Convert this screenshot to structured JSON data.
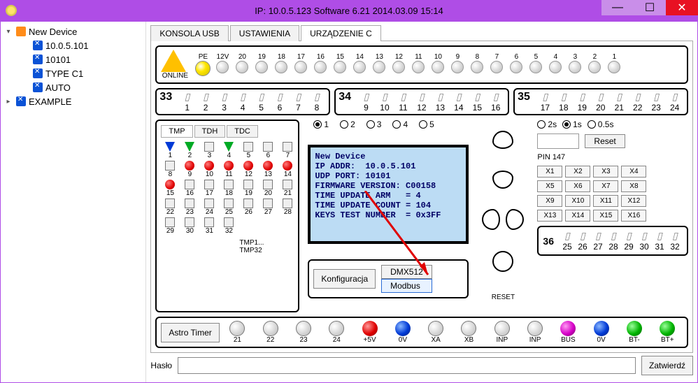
{
  "title": "IP: 10.0.5.123   Software 6.21  2014.03.09  15:14",
  "win_controls": {
    "min": "—",
    "max": "☐",
    "close": "✕"
  },
  "tree": [
    {
      "level": 0,
      "expand": "▾",
      "color": "orange",
      "label": "New Device"
    },
    {
      "level": 1,
      "color": "blue",
      "label": "10.0.5.101"
    },
    {
      "level": 1,
      "color": "blue",
      "label": "10101"
    },
    {
      "level": 1,
      "color": "blue",
      "label": "TYPE C1"
    },
    {
      "level": 1,
      "color": "blue",
      "label": "AUTO"
    },
    {
      "level": 0,
      "expand": "▸",
      "color": "blue",
      "label": "EXAMPLE"
    }
  ],
  "tabs": [
    {
      "label": "KONSOLA USB",
      "active": false
    },
    {
      "label": "USTAWIENIA",
      "active": false
    },
    {
      "label": "URZĄDZENIE C",
      "active": true
    }
  ],
  "online_label": "ONLINE",
  "top_channels": [
    "PE",
    "12V",
    "20",
    "19",
    "18",
    "17",
    "16",
    "15",
    "14",
    "13",
    "12",
    "11",
    "10",
    "9",
    "8",
    "7",
    "6",
    "5",
    "4",
    "3",
    "2",
    "1"
  ],
  "top_on_index": 0,
  "blocks": {
    "a": {
      "num": "33",
      "labels": [
        "1",
        "2",
        "3",
        "4",
        "5",
        "6",
        "7",
        "8"
      ]
    },
    "b": {
      "num": "34",
      "labels": [
        "9",
        "10",
        "11",
        "12",
        "13",
        "14",
        "15",
        "16"
      ]
    },
    "c": {
      "num": "35",
      "labels": [
        "17",
        "18",
        "19",
        "20",
        "21",
        "22",
        "23",
        "24"
      ]
    }
  },
  "tmp_tabs": [
    "TMP",
    "TDH",
    "TDC"
  ],
  "tmp_cells": [
    [
      "tri-b",
      "tri-g",
      "",
      "tri-g",
      "",
      "",
      ""
    ],
    [
      "",
      "red",
      "red",
      "red",
      "red",
      "red",
      "red"
    ],
    [
      "red",
      "",
      "",
      "",
      "",
      "",
      ""
    ],
    [
      "",
      "",
      "",
      "",
      "",
      "",
      ""
    ],
    [
      "",
      "",
      "",
      "",
      "",
      "",
      ""
    ]
  ],
  "tmp_nums": [
    [
      "1",
      "2",
      "3",
      "4",
      "5",
      "6",
      "7"
    ],
    [
      "8",
      "9",
      "10",
      "11",
      "12",
      "13",
      "14"
    ],
    [
      "15",
      "16",
      "17",
      "18",
      "19",
      "20",
      "21"
    ],
    [
      "22",
      "23",
      "24",
      "25",
      "26",
      "27",
      "28"
    ],
    [
      "29",
      "30",
      "31",
      "32",
      "",
      "",
      ""
    ]
  ],
  "tmp_extra1": "TMP1...",
  "tmp_extra2": "TMP32",
  "radio_15": [
    "1",
    "2",
    "3",
    "4",
    "5"
  ],
  "radio_sel": 0,
  "terminal_text": "New Device\nIP ADDR:  10.0.5.101\nUDP PORT: 10101\nFIRMWARE VERSION: C00158\nTIME UPDATE ARM   = 4\nTIME UPDATE COUNT = 104\nKEYS TEST NUMBER  = 0x3FF",
  "cfg": {
    "konf": "Konfiguracja",
    "dmx": "DMX512",
    "modbus": "Modbus"
  },
  "reset_label": "RESET",
  "timing": [
    "2s",
    "1s",
    "0.5s"
  ],
  "timing_sel": 1,
  "reset_btn": "Reset",
  "pin_label": "PIN 147",
  "x_buttons": [
    "X1",
    "X2",
    "X3",
    "X4",
    "X5",
    "X6",
    "X7",
    "X8",
    "X9",
    "X10",
    "X11",
    "X12",
    "X13",
    "X14",
    "X15",
    "X16"
  ],
  "block36": {
    "num": "36",
    "labels": [
      "25",
      "26",
      "27",
      "28",
      "29",
      "30",
      "31",
      "32"
    ]
  },
  "bottom": {
    "astro": "Astro Timer",
    "terms": [
      {
        "lbl": "21",
        "col": ""
      },
      {
        "lbl": "22",
        "col": ""
      },
      {
        "lbl": "23",
        "col": ""
      },
      {
        "lbl": "24",
        "col": ""
      },
      {
        "lbl": "+5V",
        "col": "red"
      },
      {
        "lbl": "0V",
        "col": "blue"
      },
      {
        "lbl": "XA",
        "col": ""
      },
      {
        "lbl": "XB",
        "col": ""
      },
      {
        "lbl": "INP",
        "col": ""
      },
      {
        "lbl": "INP",
        "col": ""
      },
      {
        "lbl": "BUS",
        "col": "mag"
      },
      {
        "lbl": "0V",
        "col": "blue"
      },
      {
        "lbl": "BT-",
        "col": "grn"
      },
      {
        "lbl": "BT+",
        "col": "grn"
      }
    ]
  },
  "password_label": "Hasło",
  "confirm_btn": "Zatwierdź"
}
